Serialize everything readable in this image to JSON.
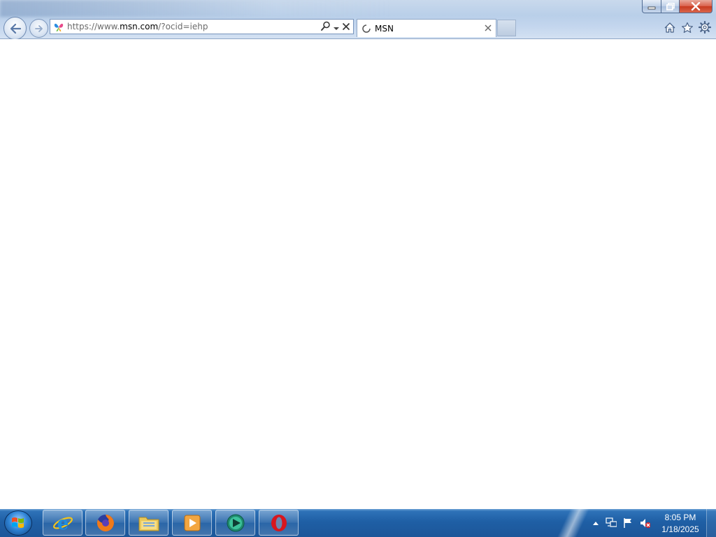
{
  "browser": {
    "address": {
      "prefix": "https://www.",
      "domain": "msn.com",
      "path": "/?ocid=iehp"
    },
    "tab": {
      "title": "MSN"
    }
  },
  "icons": {
    "back": "back-arrow-icon",
    "forward": "forward-arrow-icon",
    "search": "search-icon",
    "home": "home-icon",
    "favorites": "star-icon",
    "settings": "gear-icon"
  },
  "taskbar": {
    "pinned": [
      {
        "name": "internet-explorer-icon"
      },
      {
        "name": "firefox-icon"
      },
      {
        "name": "file-explorer-icon"
      },
      {
        "name": "media-player-icon"
      },
      {
        "name": "media-center-icon"
      },
      {
        "name": "opera-icon"
      }
    ],
    "clock": {
      "time": "8:05 PM",
      "date": "1/18/2025"
    }
  }
}
